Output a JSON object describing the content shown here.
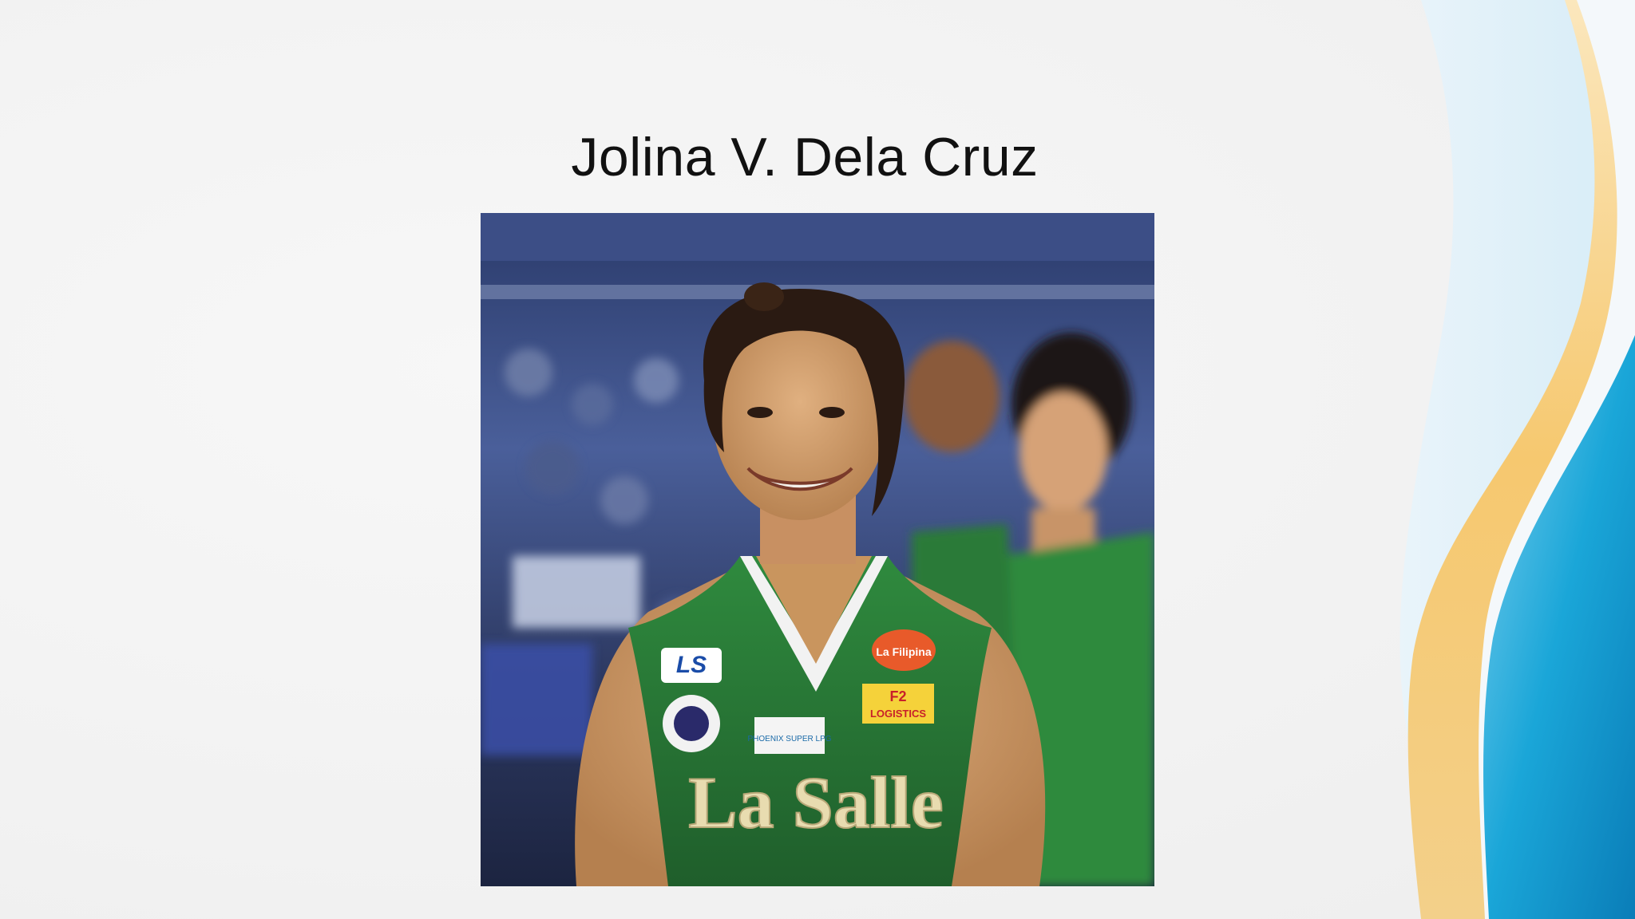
{
  "slide": {
    "title": "Jolina V. Dela Cruz",
    "photo": {
      "subject": "smiling volleyball player in green jersey",
      "jersey_text": "La Salle",
      "patches": [
        "LS",
        "La Filipina",
        "F2 LOGISTICS",
        "PHOENIX SUPER LPG"
      ]
    }
  },
  "colors": {
    "background": "#f3f3f3",
    "wave_blue": "#1aa3d4",
    "wave_gold": "#f5c76a",
    "jersey_green": "#2e7d3a"
  }
}
